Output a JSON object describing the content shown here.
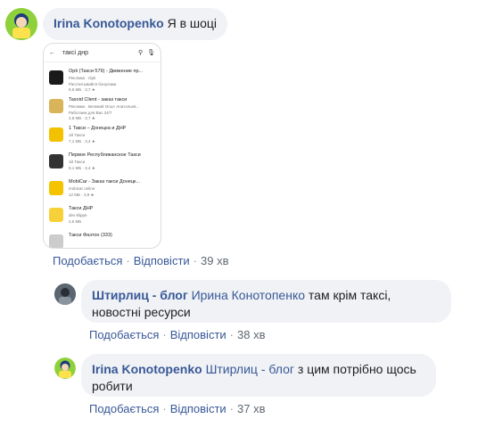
{
  "comment1": {
    "author": "Irina Konotopenko",
    "text": "Я в шоці",
    "like": "Подобається",
    "reply": "Відповісти",
    "time": "39 хв"
  },
  "screenshot": {
    "query": "таксі днр",
    "apps": [
      {
        "title": "Opti (Такси 579) - Движение пр...",
        "sub": "Реклама · Opti",
        "meta": "Рассчитывайся бонусами",
        "extra": "8,5 МБ · 3,7 ★",
        "color": "#1a1a1a"
      },
      {
        "title": "Taxoid Client - заказ такси",
        "sub": "Реклама · Великий Опыт Анатольев...",
        "meta": "Работаем для Вас 24/7",
        "extra": "4,8 МБ · 3,7 ★",
        "color": "#d9b45a"
      },
      {
        "title": "1 Такси – Донецка и ДНР",
        "sub": "1й Такси",
        "meta": "",
        "extra": "7,1 МБ · 3,4 ★",
        "color": "#f2c200"
      },
      {
        "title": "Первое Республиканское Такси",
        "sub": "1й Такси",
        "meta": "",
        "extra": "8,1 МБ · 3,4 ★",
        "color": "#333333"
      },
      {
        "title": "MobiCar - Заказ такси Донецк...",
        "sub": "mobicar online",
        "meta": "",
        "extra": "12 МБ · 3,9 ★",
        "color": "#f4c400"
      },
      {
        "title": "Такси ДНР",
        "sub": "dev-klippe",
        "meta": "",
        "extra": "2,6 МБ",
        "color": "#f7d13a"
      },
      {
        "title": "Такси Фаэтон (333)",
        "sub": "",
        "meta": "",
        "extra": "",
        "color": "#cccccc"
      }
    ]
  },
  "comment2": {
    "author": "Штирлиц - блог",
    "mention": "Ирина Конотопенко",
    "text_line1": "там крім таксі,",
    "text_line2": "новостні ресурси",
    "like": "Подобається",
    "reply": "Відповісти",
    "time": "38 хв"
  },
  "comment3": {
    "author": "Irina Konotopenko",
    "mention": "Штирлиц - блог",
    "text_line1": "з цим потрібно щось",
    "text_line2": "робити",
    "like": "Подобається",
    "reply": "Відповісти",
    "time": "37 хв"
  },
  "colors": {
    "link": "#385898",
    "bubble": "#f0f2f5",
    "avatar_green": "#7cc92b"
  },
  "icons": [
    "back-arrow-icon",
    "search-icon",
    "mic-icon",
    "avatar-irina",
    "avatar-shtirlits"
  ]
}
